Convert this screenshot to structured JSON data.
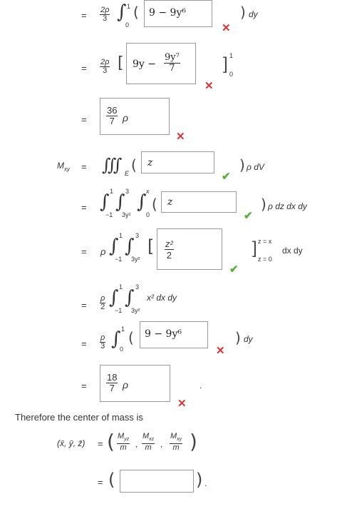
{
  "rows": {
    "r1": {
      "eq": "=",
      "coef_num": "2ρ",
      "coef_den": "3",
      "int_upper": "1",
      "int_lower": "0",
      "box_value": "9 − 9y⁶",
      "suffix": "dy"
    },
    "r2": {
      "eq": "=",
      "coef_num": "2ρ",
      "coef_den": "3",
      "box_lead": "9y −",
      "box_num": "9y⁷",
      "box_den": "7",
      "bar_upper": "1",
      "bar_lower": "0"
    },
    "r3": {
      "eq": "=",
      "box_num": "36",
      "box_den": "7",
      "box_rho": "ρ"
    },
    "r4": {
      "label_M": "M",
      "label_sub": "xy",
      "eq": "=",
      "triple_int": "∭",
      "region": "E",
      "box_value": "z",
      "suffix": "ρ dV"
    },
    "r5": {
      "eq": "=",
      "i1_up": "1",
      "i1_lo": "−1",
      "i2_up": "3",
      "i2_lo": "3y²",
      "i3_up": "x",
      "i3_lo": "0",
      "box_value": "z",
      "suffix": "ρ dz dx dy"
    },
    "r6": {
      "eq": "=",
      "rho": "ρ",
      "i1_up": "1",
      "i1_lo": "−1",
      "i2_up": "3",
      "i2_lo": "3y²",
      "box_num": "z²",
      "box_den": "2",
      "bar_up": "z = x",
      "bar_lo": "z = 0",
      "suffix": "dx dy"
    },
    "r7": {
      "eq": "=",
      "coef_num": "ρ",
      "coef_den": "2",
      "i1_up": "1",
      "i1_lo": "−1",
      "i2_up": "3",
      "i2_lo": "3y²",
      "integrand": "x² dx dy"
    },
    "r8": {
      "eq": "=",
      "coef_num": "ρ",
      "coef_den": "3",
      "int_upper": "1",
      "int_lower": "0",
      "box_value": "9 − 9y⁶",
      "suffix": "dy"
    },
    "r9": {
      "eq": "=",
      "box_num": "18",
      "box_den": "7",
      "box_rho": "ρ",
      "trailing": "."
    }
  },
  "conclusion": {
    "text": "Therefore the center of mass is",
    "lhs": "(x̄, ȳ, z̄)",
    "eq": "=",
    "f1_num": "M",
    "f1_sub": "yz",
    "f1_den": "m",
    "f2_num": "M",
    "f2_sub": "xz",
    "f2_den": "m",
    "f3_num": "M",
    "f3_sub": "xy",
    "f3_den": "m",
    "answer_eq": "=",
    "answer_value": "",
    "answer_trailing": "."
  },
  "icons": {
    "wrong": "✕",
    "right": "✔"
  }
}
